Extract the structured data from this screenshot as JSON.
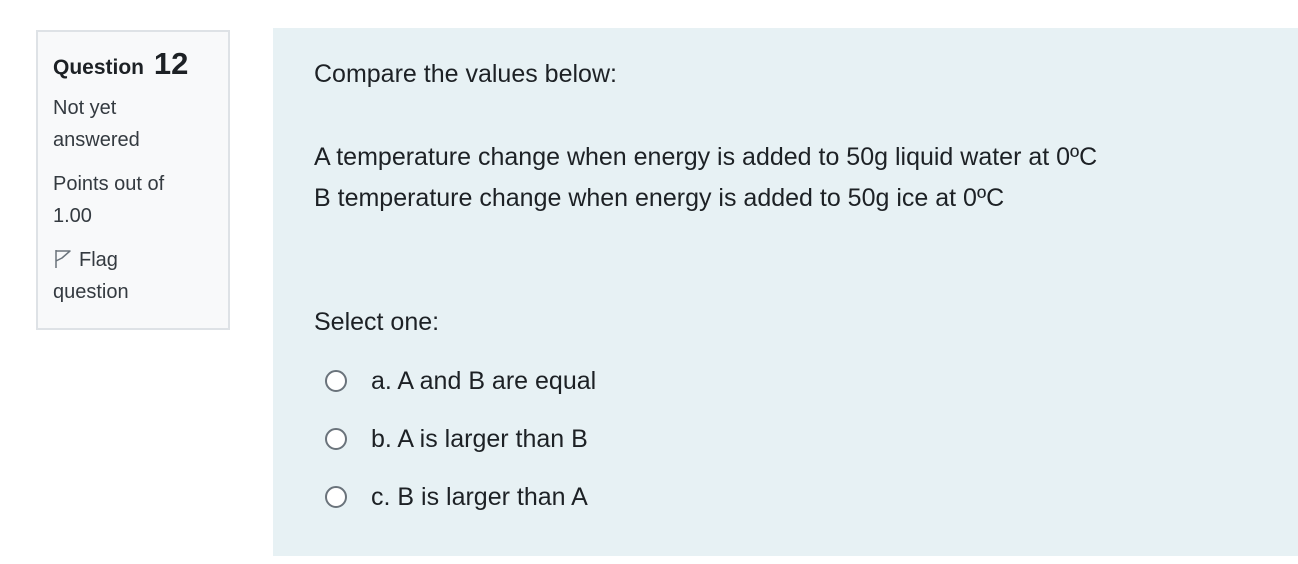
{
  "info": {
    "question_label": "Question",
    "question_number": "12",
    "state_line1": "Not yet",
    "state_line2": "answered",
    "grade_line1": "Points out of",
    "grade_line2": "1.00",
    "flag_line1": "Flag",
    "flag_line2": "question"
  },
  "question": {
    "intro": "Compare the values below:",
    "line_a": "A temperature change when energy is added to 50g liquid water at 0ºC",
    "line_b": "B temperature change when energy is added to 50g ice at 0ºC",
    "prompt": "Select one:",
    "options": [
      {
        "label": "a. A and B are equal",
        "selected": false
      },
      {
        "label": "b. A is larger than B",
        "selected": false
      },
      {
        "label": "c. B is larger than A",
        "selected": false
      }
    ]
  },
  "icons": {
    "flag": "flag-outline-icon",
    "radio": "radio-circle"
  },
  "colors": {
    "info_background": "#f8f9fa",
    "info_border": "#dee2e6",
    "content_background": "#e7f1f4",
    "text": "#1d2125"
  }
}
